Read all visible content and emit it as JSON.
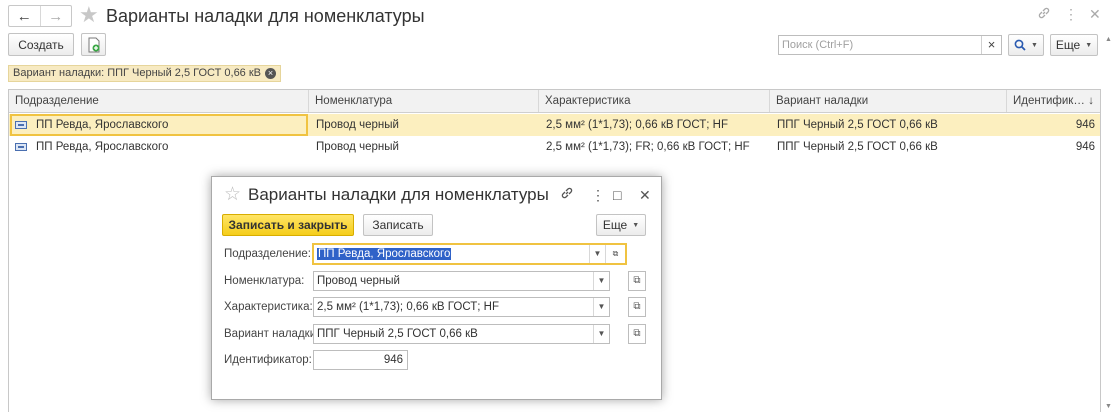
{
  "window": {
    "title": "Варианты наладки для номенклатуры",
    "back_icon": "←",
    "forward_icon": "→"
  },
  "toolbar": {
    "create_label": "Создать",
    "search_placeholder": "Поиск (Ctrl+F)",
    "search_clear": "×",
    "more_label": "Еще",
    "search_icon": "🔍︎"
  },
  "filter": {
    "chip_text": "Вариант наладки: ППГ Черный 2,5 ГОСТ 0,66 кВ"
  },
  "table": {
    "columns": [
      "Подразделение",
      "Номенклатура",
      "Характеристика",
      "Вариант наладки",
      "Идентифик…"
    ],
    "sort_indicator": "↓",
    "rows": [
      {
        "department": "ПП Ревда, Ярославского",
        "nomenclature": "Провод черный",
        "characteristic": "2,5 мм² (1*1,73); 0,66 кВ ГОСТ; HF",
        "variant": "ППГ Черный 2,5 ГОСТ 0,66 кВ",
        "id": "946",
        "selected": true
      },
      {
        "department": "ПП Ревда, Ярославского",
        "nomenclature": "Провод черный",
        "characteristic": "2,5 мм² (1*1,73); FR; 0,66 кВ ГОСТ; HF",
        "variant": "ППГ Черный 2,5 ГОСТ 0,66 кВ",
        "id": "946",
        "selected": false
      }
    ]
  },
  "dialog": {
    "title": "Варианты наладки для номенклатуры",
    "save_close_label": "Записать и закрыть",
    "save_label": "Записать",
    "more_label": "Еще",
    "fields": {
      "department_label": "Подразделение:",
      "department_value": "ПП Ревда, Ярославского",
      "nomenclature_label": "Номенклатура:",
      "nomenclature_value": "Провод черный",
      "characteristic_label": "Характеристика:",
      "characteristic_value": "2,5 мм² (1*1,73); 0,66 кВ ГОСТ; HF",
      "variant_label": "Вариант наладки:",
      "variant_value": "ППГ Черный 2,5 ГОСТ 0,66 кВ",
      "id_label": "Идентификатор:",
      "id_value": "946"
    }
  },
  "colors": {
    "accent_yellow": "#f5cd1a",
    "selection_row": "#fcefbf",
    "text_selection": "#2f62c8"
  }
}
